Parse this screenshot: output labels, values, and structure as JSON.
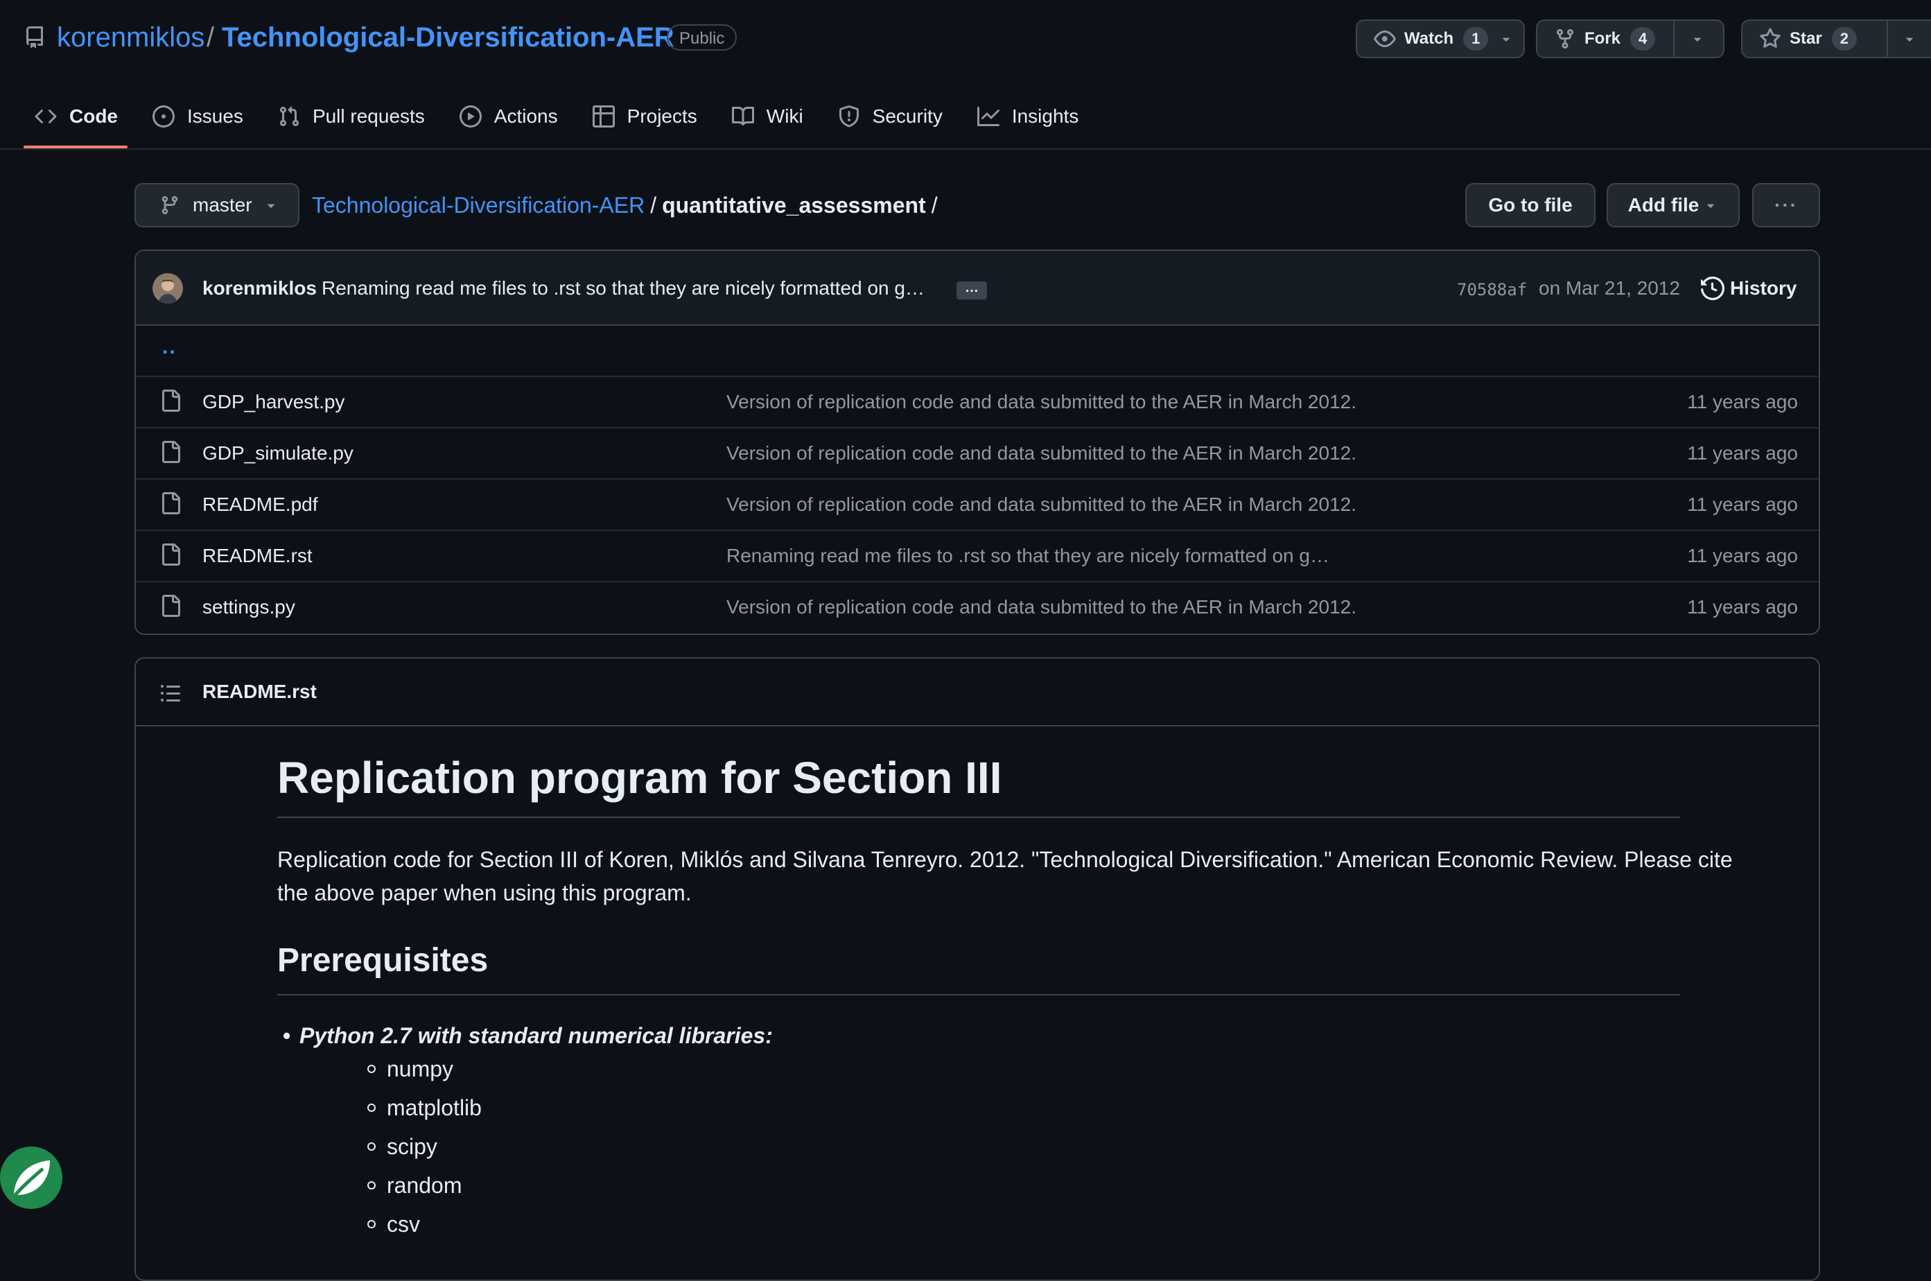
{
  "repo": {
    "owner": "korenmiklos",
    "separator": "/",
    "name": "Technological-Diversification-AER",
    "visibility": "Public"
  },
  "actions": {
    "watch": {
      "label": "Watch",
      "count": "1"
    },
    "fork": {
      "label": "Fork",
      "count": "4"
    },
    "star": {
      "label": "Star",
      "count": "2"
    }
  },
  "tabs": [
    {
      "label": "Code",
      "icon": "code-icon",
      "active": true
    },
    {
      "label": "Issues",
      "icon": "issue-icon"
    },
    {
      "label": "Pull requests",
      "icon": "pull-request-icon"
    },
    {
      "label": "Actions",
      "icon": "play-icon"
    },
    {
      "label": "Projects",
      "icon": "table-icon"
    },
    {
      "label": "Wiki",
      "icon": "book-icon"
    },
    {
      "label": "Security",
      "icon": "shield-icon"
    },
    {
      "label": "Insights",
      "icon": "graph-icon"
    }
  ],
  "branch": "master",
  "breadcrumb": {
    "root": "Technological-Diversification-AER",
    "sep": "/",
    "current": "quantitative_assessment",
    "trailing": "/"
  },
  "buttons": {
    "go_to_file": "Go to file",
    "add_file": "Add file",
    "more": "···"
  },
  "latest_commit": {
    "author": "korenmiklos",
    "message": "Renaming read me files to .rst so that they are nicely formatted on g…",
    "ellipsis": "…",
    "sha": "70588af",
    "date": "on Mar 21, 2012",
    "history_label": "History"
  },
  "parent_dir": "..",
  "files": [
    {
      "name": "GDP_harvest.py",
      "message": "Version of replication code and data submitted to the AER in March 2012.",
      "age": "11 years ago"
    },
    {
      "name": "GDP_simulate.py",
      "message": "Version of replication code and data submitted to the AER in March 2012.",
      "age": "11 years ago"
    },
    {
      "name": "README.pdf",
      "message": "Version of replication code and data submitted to the AER in March 2012.",
      "age": "11 years ago"
    },
    {
      "name": "README.rst",
      "message": "Renaming read me files to .rst so that they are nicely formatted on g…",
      "age": "11 years ago"
    },
    {
      "name": "settings.py",
      "message": "Version of replication code and data submitted to the AER in March 2012.",
      "age": "11 years ago"
    }
  ],
  "readme": {
    "filename": "README.rst",
    "h1": "Replication program for Section III",
    "p1": "Replication code for Section III of Koren, Miklós and Silvana Tenreyro. 2012. \"Technological Diversification.\" American Economic Review. Please cite the above paper when using this program.",
    "h2": "Prerequisites",
    "li1": "Python 2.7 with standard numerical libraries:",
    "sublist": [
      "numpy",
      "matplotlib",
      "scipy",
      "random",
      "csv"
    ]
  },
  "colors": {
    "background": "#0d1117",
    "link": "#4493f8",
    "muted": "#9198a1",
    "border": "#3d444d",
    "tab_underline": "#f78166"
  }
}
